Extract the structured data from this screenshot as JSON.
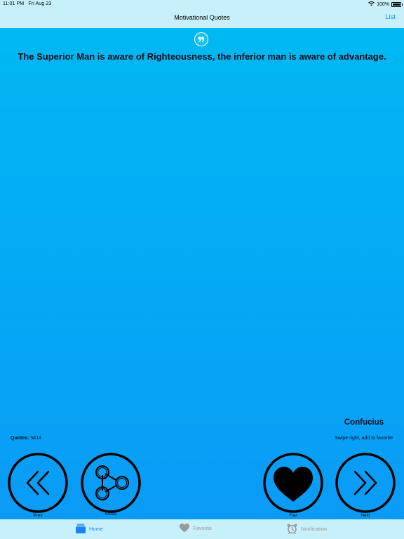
{
  "status_bar": {
    "time": "11:01 PM",
    "date": "Fri Aug 23",
    "battery": "100%",
    "icons": [
      "wifi-icon",
      "battery-icon"
    ]
  },
  "nav": {
    "title": "Motivational Quotes",
    "right_button": "List"
  },
  "quote": {
    "text": "The Superior Man is aware of Righteousness, the inferior man is aware of advantage.",
    "author": "Confucius",
    "icon": "quote-mark-icon"
  },
  "info": {
    "quotes_label": "Quotes:",
    "quotes_count": "5414",
    "swipe_hint": "Swipe right, add to favorite"
  },
  "buttons": {
    "prev": "Prev",
    "share": "Share",
    "fav": "Fav",
    "next": "Next"
  },
  "tabs": [
    {
      "label": "Home",
      "icon": "home-stack-icon",
      "active": true
    },
    {
      "label": "Favorite",
      "icon": "heart-icon",
      "active": false
    },
    {
      "label": "Notification",
      "icon": "alarm-clock-icon",
      "active": false
    }
  ],
  "colors": {
    "accent": "#1b84f2",
    "bar_background": "#c8f0fb",
    "gradient_top": "#00b8f2",
    "gradient_bottom": "#0a9bf7",
    "inactive_tab": "#9a9a9a"
  }
}
